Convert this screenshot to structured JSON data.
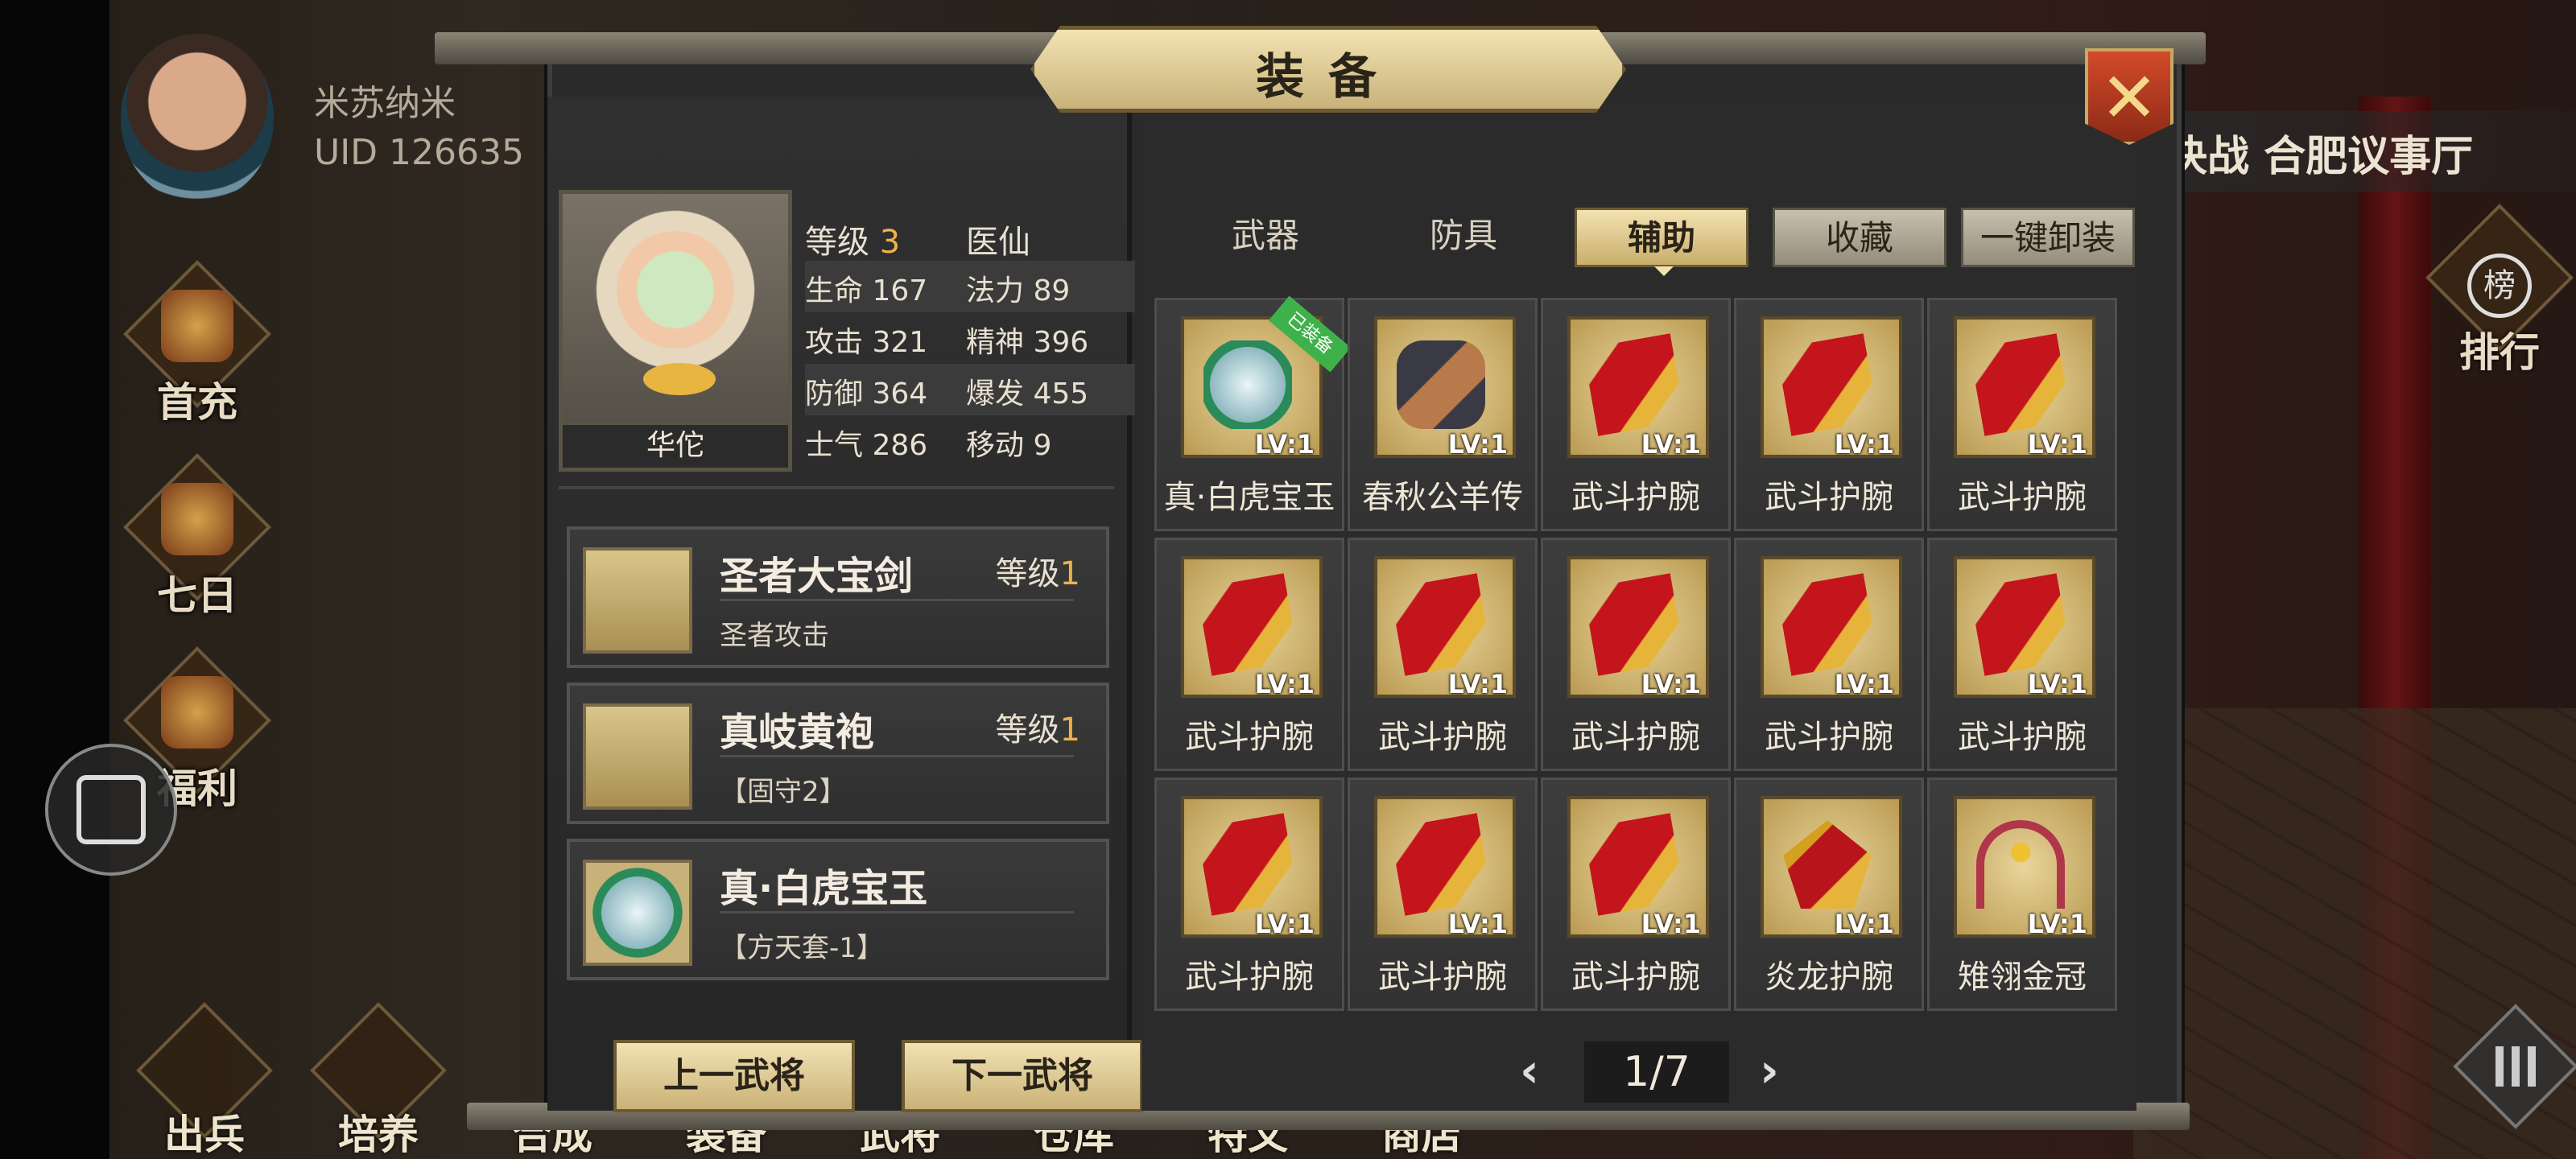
{
  "player": {
    "name": "米苏纳米",
    "uid": "UID  126635"
  },
  "left_hud": [
    {
      "label": "首充",
      "icon": "gift-icon"
    },
    {
      "label": "七日",
      "icon": "scroll-icon"
    },
    {
      "label": "福利",
      "icon": "treasure-icon"
    }
  ],
  "right_hud": {
    "quest": "决战 合肥议事厅",
    "rank_label": "排行",
    "rank_seal": "榜"
  },
  "bottom_nav": [
    "出兵",
    "培养",
    "合成",
    "装备",
    "武将",
    "仓库",
    "特文",
    "商店"
  ],
  "modal": {
    "title": "装备",
    "close_symbol": "✕",
    "hero": {
      "name": "华佗",
      "level_label": "等级",
      "level": "3",
      "class": "医仙",
      "stats": [
        {
          "l1": "生命",
          "v1": "167",
          "l2": "法力",
          "v2": "89"
        },
        {
          "l1": "攻击",
          "v1": "321",
          "l2": "精神",
          "v2": "396"
        },
        {
          "l1": "防御",
          "v1": "364",
          "l2": "爆发",
          "v2": "455"
        },
        {
          "l1": "士气",
          "v1": "286",
          "l2": "移动",
          "v2": "9"
        }
      ]
    },
    "equipped": [
      {
        "name": "圣者大宝剑",
        "level_label": "等级",
        "level": "1",
        "sub": "圣者攻击",
        "icon": "sword-icon"
      },
      {
        "name": "真岐黄袍",
        "level_label": "等级",
        "level": "1",
        "sub": "【固守2】",
        "icon": "robe-icon"
      },
      {
        "name": "真·白虎宝玉",
        "level_label": "",
        "level": "",
        "sub": "【方天套-1】",
        "icon": "gem-icon"
      }
    ],
    "buttons": {
      "prev": "上一武将",
      "next": "下一武将"
    },
    "tabs": [
      "武器",
      "防具",
      "辅助",
      "收藏",
      "一键卸装"
    ],
    "active_tab": "辅助",
    "inventory": [
      {
        "name": "真·白虎宝玉",
        "lv": "LV:1",
        "art": "gem",
        "tag": "已装备"
      },
      {
        "name": "春秋公羊传",
        "lv": "LV:1",
        "art": "scroll",
        "tag": ""
      },
      {
        "name": "武斗护腕",
        "lv": "LV:1",
        "art": "bracer",
        "tag": ""
      },
      {
        "name": "武斗护腕",
        "lv": "LV:1",
        "art": "bracer",
        "tag": ""
      },
      {
        "name": "武斗护腕",
        "lv": "LV:1",
        "art": "bracer",
        "tag": ""
      },
      {
        "name": "武斗护腕",
        "lv": "LV:1",
        "art": "bracer",
        "tag": ""
      },
      {
        "name": "武斗护腕",
        "lv": "LV:1",
        "art": "bracer",
        "tag": ""
      },
      {
        "name": "武斗护腕",
        "lv": "LV:1",
        "art": "bracer",
        "tag": ""
      },
      {
        "name": "武斗护腕",
        "lv": "LV:1",
        "art": "bracer",
        "tag": ""
      },
      {
        "name": "武斗护腕",
        "lv": "LV:1",
        "art": "bracer",
        "tag": ""
      },
      {
        "name": "武斗护腕",
        "lv": "LV:1",
        "art": "bracer",
        "tag": ""
      },
      {
        "name": "武斗护腕",
        "lv": "LV:1",
        "art": "bracer",
        "tag": ""
      },
      {
        "name": "武斗护腕",
        "lv": "LV:1",
        "art": "bracer",
        "tag": ""
      },
      {
        "name": "炎龙护腕",
        "lv": "LV:1",
        "art": "dragon",
        "tag": ""
      },
      {
        "name": "雉翎金冠",
        "lv": "LV:1",
        "art": "crown",
        "tag": ""
      }
    ],
    "pager": {
      "prev": "‹",
      "page": "1/7",
      "next": "›"
    }
  },
  "colors": {
    "accent_gold": "#f0b24a",
    "tab_gold": "#f3e2b0",
    "close_red": "#d34a2a",
    "equipped_green": "#3fb14a"
  }
}
